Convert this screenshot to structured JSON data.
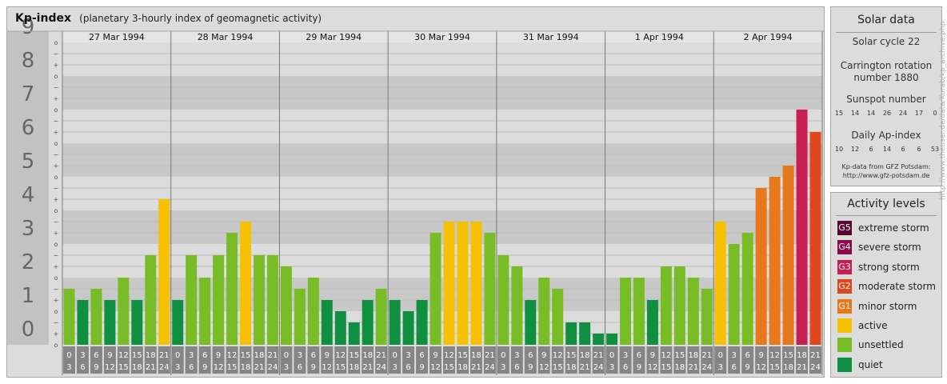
{
  "header": {
    "title": "Kp-index",
    "subtitle": "(planetary 3-hourly index of geomagnetic activity)"
  },
  "chart_data": {
    "type": "bar",
    "title": "Kp-index",
    "subtitle": "(planetary 3-hourly index of geomagnetic activity)",
    "ylim": [
      0,
      9
    ],
    "y_ticks": [
      "0",
      "1",
      "2",
      "3",
      "4",
      "5",
      "6",
      "7",
      "8",
      "9"
    ],
    "sub_tick_labels": [
      "o",
      "+",
      "−",
      "o",
      "+",
      "−",
      "o",
      "+",
      "−",
      "o",
      "+",
      "−",
      "o",
      "+",
      "−",
      "o",
      "+",
      "−",
      "o",
      "+",
      "−",
      "o",
      "+",
      "−",
      "o",
      "+",
      "−",
      "o"
    ],
    "days": [
      "27 Mar 1994",
      "28 Mar 1994",
      "29 Mar 1994",
      "30 Mar 1994",
      "31 Mar 1994",
      "1 Apr 1994",
      "2 Apr 1994"
    ],
    "interval_start_labels": [
      "0",
      "3",
      "6",
      "9",
      "12",
      "15",
      "18",
      "21"
    ],
    "interval_end_labels": [
      "3",
      "6",
      "9",
      "12",
      "15",
      "18",
      "21",
      "24"
    ],
    "values": [
      1.667,
      1.333,
      1.667,
      1.333,
      2.0,
      1.333,
      2.667,
      4.333,
      1.333,
      2.667,
      2.0,
      2.667,
      3.333,
      3.667,
      2.667,
      2.667,
      2.333,
      1.667,
      2.0,
      1.333,
      1.0,
      0.667,
      1.333,
      1.667,
      1.333,
      1.0,
      1.333,
      3.333,
      3.667,
      3.667,
      3.667,
      3.333,
      2.667,
      2.333,
      1.333,
      2.0,
      1.667,
      0.667,
      0.667,
      0.333,
      0.333,
      2.0,
      2.0,
      1.333,
      2.333,
      2.333,
      2.0,
      1.667,
      3.667,
      3.0,
      3.333,
      4.667,
      5.0,
      5.333,
      7.0,
      6.333
    ],
    "level_colors": {
      "quiet": "#0f8f3f",
      "unsettled": "#79bd26",
      "active": "#f6c102",
      "g1": "#e7781c",
      "g2": "#e0481c",
      "g3": "#c71f53",
      "g4": "#9c0f53",
      "g5": "#5b0631"
    },
    "grid": true
  },
  "solar": {
    "title": "Solar data",
    "cycle": "Solar cycle 22",
    "carrington_line1": "Carrington rotation",
    "carrington_line2": "number 1880",
    "sunspot_title": "Sunspot number",
    "sunspot_values": [
      "15",
      "14",
      "14",
      "26",
      "24",
      "17",
      "0"
    ],
    "ap_title": "Daily Ap-index",
    "ap_values": [
      "10",
      "12",
      "6",
      "14",
      "6",
      "6",
      "53"
    ],
    "source_line1": "Kp-data from GFZ Potsdam:",
    "source_line2": "http://www.gfz-potsdam.de"
  },
  "legend": {
    "title": "Activity levels",
    "items": [
      {
        "code": "G5",
        "label": "extreme storm",
        "color": "#5b0631"
      },
      {
        "code": "G4",
        "label": "severe storm",
        "color": "#8c0a4a"
      },
      {
        "code": "G3",
        "label": "strong storm",
        "color": "#c71f53"
      },
      {
        "code": "G2",
        "label": "moderate storm",
        "color": "#e0481c"
      },
      {
        "code": "G1",
        "label": "minor storm",
        "color": "#e7781c"
      },
      {
        "code": "",
        "label": "active",
        "color": "#f6c102"
      },
      {
        "code": "",
        "label": "unsettled",
        "color": "#79bd26"
      },
      {
        "code": "",
        "label": "quiet",
        "color": "#0f8f3f"
      }
    ]
  },
  "watermark": "http://www.theuser.de/data/Kurab/kp_archive.php"
}
